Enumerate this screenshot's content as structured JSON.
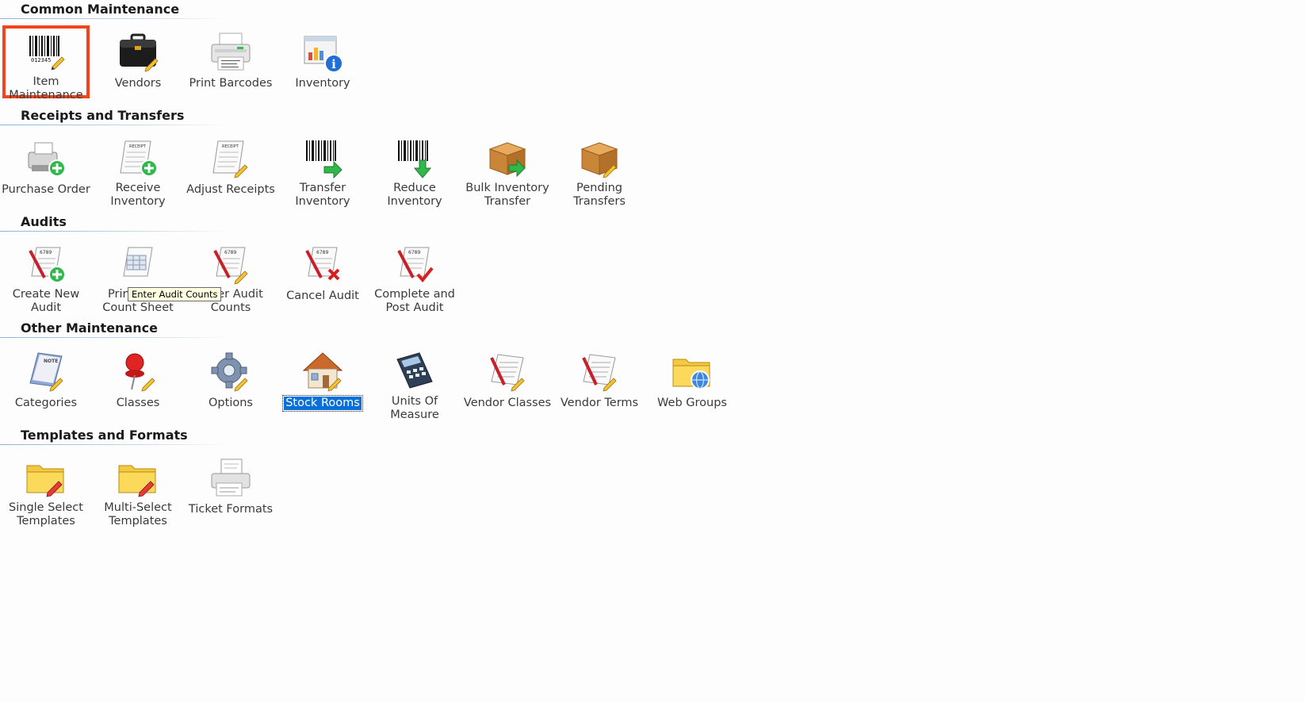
{
  "sections": [
    {
      "title": "Common Maintenance",
      "items": [
        {
          "label": "Item Maintenance",
          "icon": "barcode-icon"
        },
        {
          "label": "Vendors",
          "icon": "briefcase-icon"
        },
        {
          "label": "Print Barcodes",
          "icon": "printer-icon"
        },
        {
          "label": "Inventory",
          "icon": "inventory-info-icon"
        }
      ]
    },
    {
      "title": "Receipts and Transfers",
      "items": [
        {
          "label": "Purchase Order",
          "icon": "purchase-order-icon"
        },
        {
          "label": "Receive Inventory",
          "icon": "receipt-add-icon"
        },
        {
          "label": "Adjust Receipts",
          "icon": "receipt-edit-icon"
        },
        {
          "label": "Transfer Inventory",
          "icon": "barcode-transfer-icon"
        },
        {
          "label": "Reduce Inventory",
          "icon": "barcode-reduce-icon"
        },
        {
          "label": "Bulk Inventory Transfer",
          "icon": "box-transfer-icon"
        },
        {
          "label": "Pending Transfers",
          "icon": "box-pending-icon"
        }
      ]
    },
    {
      "title": "Audits",
      "items": [
        {
          "label": "Create New Audit",
          "icon": "audit-add-icon"
        },
        {
          "label": "Print Audit Count Sheet",
          "icon": "audit-print-icon"
        },
        {
          "label": "Enter Audit Counts",
          "icon": "audit-edit-icon"
        },
        {
          "label": "Cancel Audit",
          "icon": "audit-cancel-icon"
        },
        {
          "label": "Complete and Post Audit",
          "icon": "audit-complete-icon"
        }
      ]
    },
    {
      "title": "Other Maintenance",
      "items": [
        {
          "label": "Categories",
          "icon": "notepad-icon"
        },
        {
          "label": "Classes",
          "icon": "pushpin-icon"
        },
        {
          "label": "Options",
          "icon": "gear-icon"
        },
        {
          "label": "Stock Rooms",
          "icon": "house-icon"
        },
        {
          "label": "Units Of Measure",
          "icon": "calculator-icon"
        },
        {
          "label": "Vendor Classes",
          "icon": "document-pencil-icon"
        },
        {
          "label": "Vendor Terms",
          "icon": "document-pencil-icon"
        },
        {
          "label": "Web Groups",
          "icon": "folder-globe-icon"
        }
      ]
    },
    {
      "title": "Templates and Formats",
      "items": [
        {
          "label": "Single Select Templates",
          "icon": "folder-edit-icon"
        },
        {
          "label": "Multi-Select Templates",
          "icon": "folder-edit-icon"
        },
        {
          "label": "Ticket Formats",
          "icon": "ticket-printer-icon"
        }
      ]
    }
  ],
  "tooltip": "Enter Audit Counts",
  "colors": {
    "focus_border": "#f0441c",
    "selection": "#0a6fd8",
    "section_rule": "#8fb3d6"
  }
}
